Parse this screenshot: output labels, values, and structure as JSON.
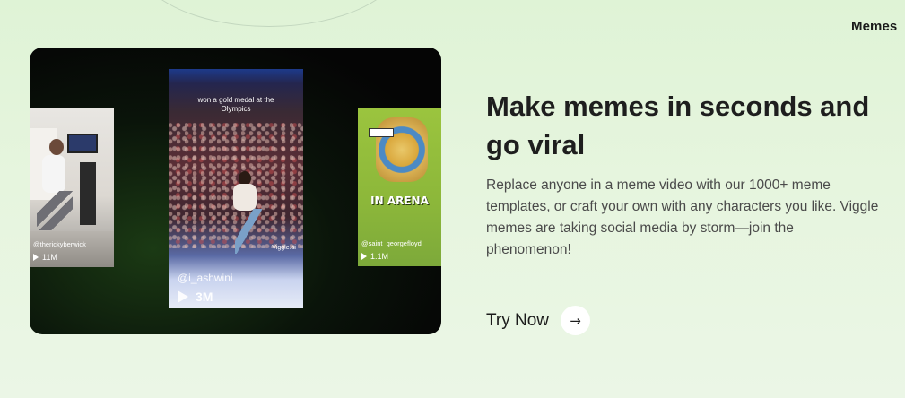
{
  "section_tab": "Memes",
  "media": {
    "left_clip": {
      "handle": "@therickyberwick",
      "views": "11M"
    },
    "center_clip": {
      "caption": "won a gold medal at the Olympics",
      "watermark": "Viggle.ai",
      "handle": "@i_ashwini",
      "views": "3M"
    },
    "right_clip": {
      "banner": "IN ARENA",
      "handle": "@saint_georgefloyd",
      "views": "1.1M"
    }
  },
  "heading": "Make memes in seconds and go viral",
  "description": "Replace anyone in a meme video with our 1000+ meme templates, or craft your own with any characters you like. Viggle memes are taking social media by storm—join the phenomenon!",
  "cta": {
    "label": "Try Now",
    "icon": "arrow-right-icon",
    "arrow_glyph": "→"
  },
  "colors": {
    "background": "#e3f4da",
    "card": "#0a0a0a",
    "heading": "#1e1e1e",
    "body_text": "#4a4a4a"
  }
}
